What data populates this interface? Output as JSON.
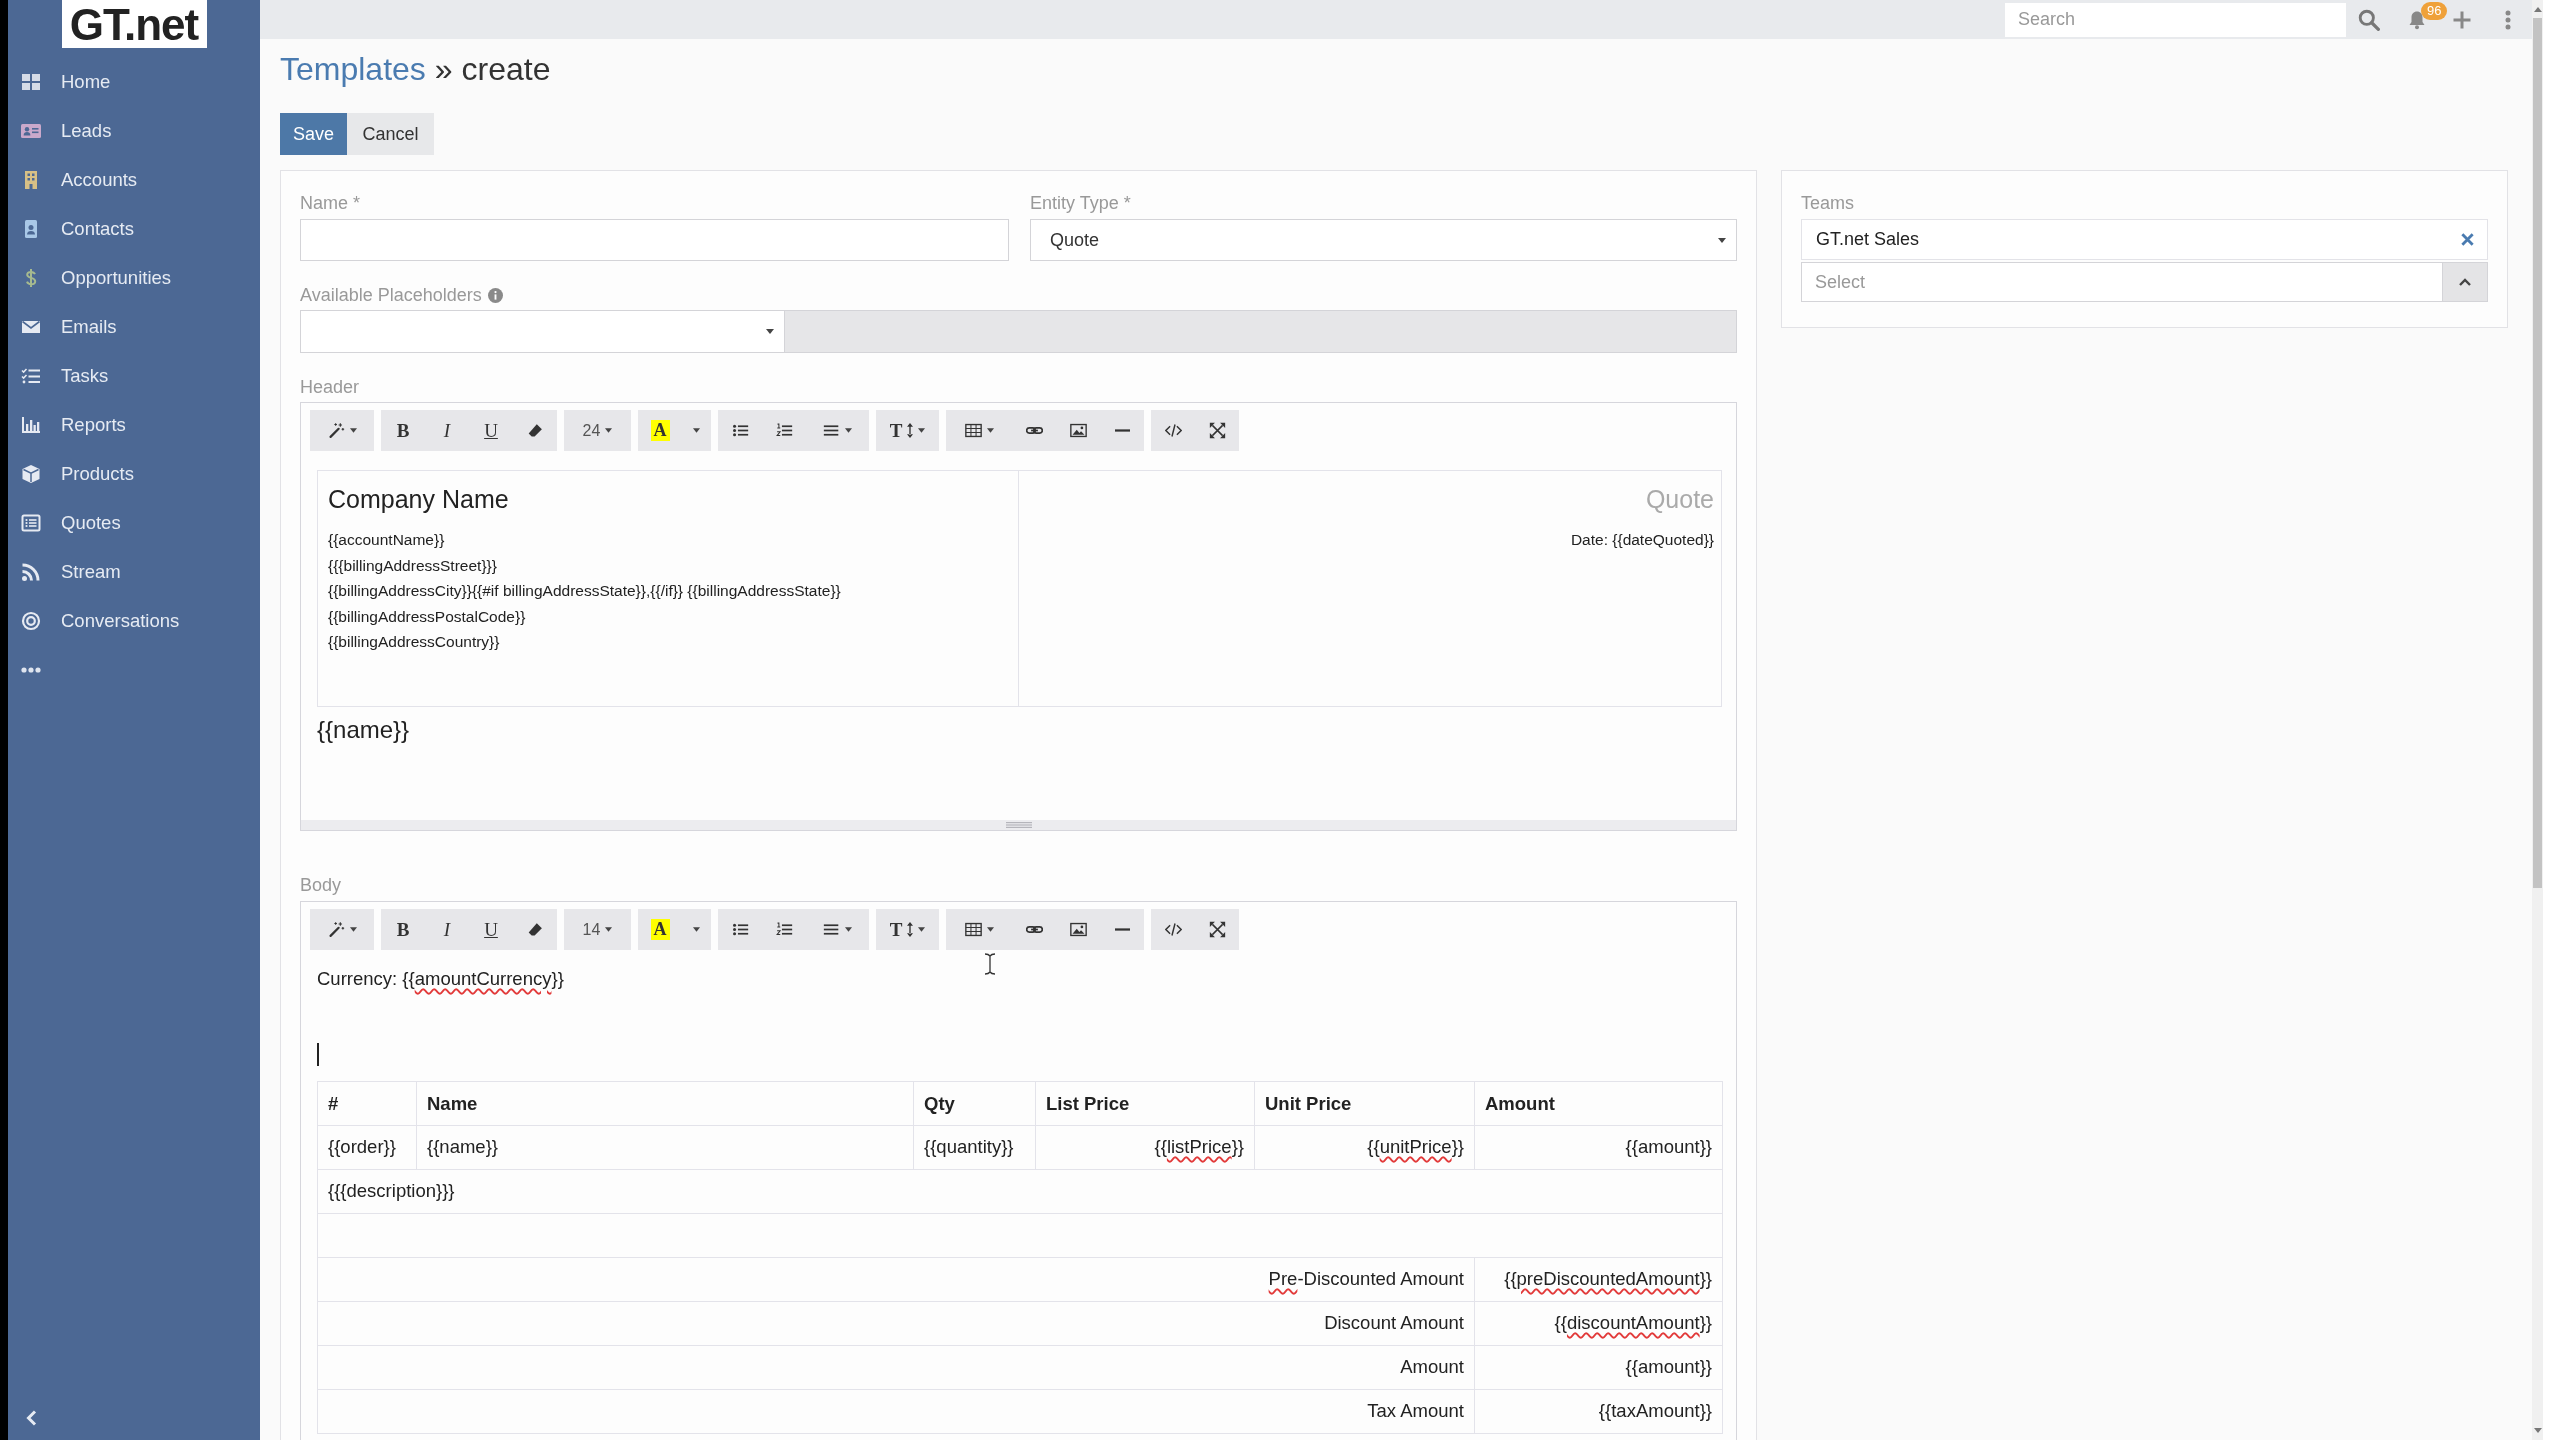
{
  "sidebar": {
    "logo": "GT.net",
    "items": [
      {
        "label": "Home"
      },
      {
        "label": "Leads"
      },
      {
        "label": "Accounts"
      },
      {
        "label": "Contacts"
      },
      {
        "label": "Opportunities"
      },
      {
        "label": "Emails"
      },
      {
        "label": "Tasks"
      },
      {
        "label": "Reports"
      },
      {
        "label": "Products"
      },
      {
        "label": "Quotes"
      },
      {
        "label": "Stream"
      },
      {
        "label": "Conversations"
      }
    ]
  },
  "top_bar": {
    "search": {
      "placeholder": "Search"
    },
    "notification_badge": "96"
  },
  "title": {
    "link": "Templates",
    "current": "» create"
  },
  "buttons": [
    {
      "label": "Save",
      "kind": "primary"
    },
    {
      "label": "Cancel",
      "kind": "default"
    }
  ],
  "form": {
    "name": {
      "label": "Name *"
    },
    "entity_type": {
      "label": "Entity Type *",
      "value": "Quote"
    },
    "available_placeholders": {
      "label": "Available Placeholders"
    },
    "header": {
      "label": "Header",
      "toolbar": [
        [
          {
            "kind": "style"
          }
        ],
        [
          {
            "kind": "bold",
            "text": "B"
          },
          {
            "kind": "italic",
            "text": "I"
          },
          {
            "kind": "underline",
            "text": "U"
          },
          {
            "kind": "clear"
          }
        ],
        [
          {
            "kind": "font-size",
            "text": "24"
          }
        ],
        [
          {
            "kind": "color",
            "text": "A"
          },
          {
            "kind": "color-menu"
          }
        ],
        [
          {
            "kind": "bullet-list"
          },
          {
            "kind": "numbered-list"
          },
          {
            "kind": "align"
          }
        ],
        [
          {
            "kind": "line-height",
            "text": "T"
          }
        ],
        [
          {
            "kind": "table"
          },
          {
            "kind": "link"
          },
          {
            "kind": "picture"
          },
          {
            "kind": "rule"
          }
        ],
        [
          {
            "kind": "code"
          },
          {
            "kind": "fullscreen"
          }
        ]
      ],
      "content": {
        "cells": [
          {
            "heading": "Company Name",
            "lines": [
              "{{accountName}}",
              "{{{billingAddressStreet}}}",
              "{{billingAddressCity}}{{#if billingAddressState}},{{/if}} {{billingAddressState}}",
              "{{billingAddressPostalCode}}",
              "{{billingAddressCountry}}"
            ]
          },
          {
            "heading": "Quote",
            "lines": [
              "Date: {{dateQuoted}}"
            ]
          }
        ],
        "after": "{{name}}"
      }
    },
    "body": {
      "label": "Body",
      "toolbar": [
        [
          {
            "kind": "style"
          }
        ],
        [
          {
            "kind": "bold",
            "text": "B"
          },
          {
            "kind": "italic",
            "text": "I"
          },
          {
            "kind": "underline",
            "text": "U"
          },
          {
            "kind": "clear"
          }
        ],
        [
          {
            "kind": "font-size",
            "text": "14"
          }
        ],
        [
          {
            "kind": "color",
            "text": "A"
          },
          {
            "kind": "color-menu"
          }
        ],
        [
          {
            "kind": "bullet-list"
          },
          {
            "kind": "numbered-list"
          },
          {
            "kind": "align"
          }
        ],
        [
          {
            "kind": "line-height",
            "text": "T"
          }
        ],
        [
          {
            "kind": "table"
          },
          {
            "kind": "link"
          },
          {
            "kind": "picture"
          },
          {
            "kind": "rule"
          }
        ],
        [
          {
            "kind": "code"
          },
          {
            "kind": "fullscreen"
          }
        ]
      ],
      "content": {
        "text_lines": [
          [
            {
              "text": "Currency: {{",
              "misspelled": false
            },
            {
              "text": "amountCurrency",
              "misspelled": true
            },
            {
              "text": "}}",
              "misspelled": false
            }
          ]
        ],
        "cursor": true,
        "table": {
          "columns": [
            "#",
            "Name",
            "Qty",
            "List Price",
            "Unit Price",
            "Amount"
          ],
          "rows": [
            {
              "kind": "item",
              "cells": [
                [
                  {
                    "text": "{{order}}",
                    "misspelled": false
                  }
                ],
                [
                  {
                    "text": "{{name}}",
                    "misspelled": false
                  }
                ],
                [
                  {
                    "text": "{{quantity}}",
                    "misspelled": false
                  }
                ],
                [
                  {
                    "text": "{{",
                    "misspelled": false
                  },
                  {
                    "text": "listPrice",
                    "misspelled": true
                  },
                  {
                    "text": "}}",
                    "misspelled": false
                  }
                ],
                [
                  {
                    "text": "{{",
                    "misspelled": false
                  },
                  {
                    "text": "unitPrice",
                    "misspelled": true
                  },
                  {
                    "text": "}}",
                    "misspelled": false
                  }
                ],
                [
                  {
                    "text": "{{amount}}",
                    "misspelled": false
                  }
                ]
              ]
            },
            {
              "kind": "description",
              "cells": [
                [
                  {
                    "text": "{{{description}}}",
                    "misspelled": false
                  }
                ]
              ]
            },
            {
              "kind": "blank"
            },
            {
              "kind": "total",
              "cells": [
                [
                  {
                    "text": "Pre",
                    "misspelled": true
                  },
                  {
                    "text": "-Discounted Amount",
                    "misspelled": false
                  }
                ],
                [
                  {
                    "text": "{{",
                    "misspelled": false
                  },
                  {
                    "text": "preDiscountedAmount",
                    "misspelled": true
                  },
                  {
                    "text": "}}",
                    "misspelled": false
                  }
                ]
              ]
            },
            {
              "kind": "total",
              "cells": [
                [
                  {
                    "text": "Discount Amount",
                    "misspelled": false
                  }
                ],
                [
                  {
                    "text": "{{",
                    "misspelled": false
                  },
                  {
                    "text": "discountAmount",
                    "misspelled": true
                  },
                  {
                    "text": "}}",
                    "misspelled": false
                  }
                ]
              ]
            },
            {
              "kind": "total",
              "cells": [
                [
                  {
                    "text": "Amount",
                    "misspelled": false
                  }
                ],
                [
                  {
                    "text": "{{amount}}",
                    "misspelled": false
                  }
                ]
              ]
            },
            {
              "kind": "total",
              "cells": [
                [
                  {
                    "text": "Tax Amount",
                    "misspelled": false
                  }
                ],
                [
                  {
                    "text": "{{taxAmount}}",
                    "misspelled": false
                  }
                ]
              ]
            }
          ]
        }
      }
    }
  },
  "teams": {
    "label": "Teams",
    "items": [
      {
        "label": "GT.net Sales"
      }
    ],
    "placeholder": "Select"
  }
}
